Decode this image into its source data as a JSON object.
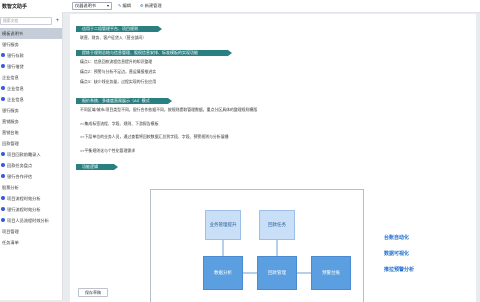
{
  "sidebar": {
    "title": "数智文助手",
    "search_placeholder": "搜索文档",
    "add_label": "+",
    "items": [
      {
        "label": "模板说明书",
        "level": 0,
        "active": true,
        "dot": ""
      },
      {
        "label": "银行服务",
        "level": 0,
        "active": false,
        "dot": ""
      },
      {
        "label": "银行存款",
        "level": 1,
        "active": false,
        "dot": "#3b5bdb"
      },
      {
        "label": "银行借贷",
        "level": 1,
        "active": false,
        "dot": "#3b5bdb"
      },
      {
        "label": "企业信息",
        "level": 0,
        "active": false,
        "dot": ""
      },
      {
        "label": "企业信息",
        "level": 1,
        "active": false,
        "dot": "#3b5bdb"
      },
      {
        "label": "企业信息",
        "level": 1,
        "active": false,
        "dot": "#3b5bdb"
      },
      {
        "label": "银行服务",
        "level": 0,
        "active": false,
        "dot": ""
      },
      {
        "label": "营销服务",
        "level": 0,
        "active": false,
        "dot": ""
      },
      {
        "label": "营销台账",
        "level": 0,
        "active": false,
        "dot": ""
      },
      {
        "label": "回款管理",
        "level": 0,
        "active": false,
        "dot": ""
      },
      {
        "label": "项目回款前瞻录入",
        "level": 1,
        "active": false,
        "dot": "#3b5bdb"
      },
      {
        "label": "回款任务盘点",
        "level": 1,
        "active": false,
        "dot": "#3b5bdb"
      },
      {
        "label": "银行合作评估",
        "level": 1,
        "active": false,
        "dot": "#3b5bdb"
      },
      {
        "label": "股票分析",
        "level": 0,
        "active": false,
        "dot": ""
      },
      {
        "label": "项目流程时效分析",
        "level": 1,
        "active": false,
        "dot": "#3b5bdb"
      },
      {
        "label": "银行流程时效分析",
        "level": 1,
        "active": false,
        "dot": "#3b5bdb"
      },
      {
        "label": "项目人员流程时效分析",
        "level": 1,
        "active": false,
        "dot": "#3b5bdb"
      },
      {
        "label": "项目管理",
        "level": 0,
        "active": false,
        "dot": ""
      },
      {
        "label": "任务清单",
        "level": 0,
        "active": false,
        "dot": ""
      }
    ]
  },
  "toolbar": {
    "doc_select": "仪器说明书",
    "edit_label": "编辑",
    "manage_label": "新建管理"
  },
  "doc": {
    "sections": [
      {
        "heading": "适用于二组管理平台、项目规则",
        "lines": [
          "联营、财务、客户征贷入（营业部间）"
        ]
      },
      {
        "heading": "提炼于规则总结与信息管理、股权信息安排、标准模板的实现功能",
        "lines": [
          "痛点1：信息回款流程信息提升的知识整理",
          "痛点2：预警与分析不足边，营运情报推进实",
          "痛点3：缺少线业务量，过程实现的行业应用"
        ]
      },
      {
        "heading": "报价系统、多维度直观展示（AI）模式",
        "lines": [
          "不同区域/城市/项目类型不同，银行合作依据不同，按规则提取管理数据，重点分区具体的整理规则模版",
          ">>集成标签流程、字段、规则、下游报告模板",
          ">>下层单位的业务人员，通过查看将回款数据汇总到字段、字段、预警规则与分析展播",
          ">>平衡规则化与个性化管理需求"
        ]
      },
      {
        "heading": "功能逻辑",
        "lines": []
      }
    ],
    "diagram": {
      "boxes": [
        {
          "label": "业务管理提升",
          "style": "light"
        },
        {
          "label": "回款任务",
          "style": "light"
        },
        {
          "label": "数据分析",
          "style": "dark"
        },
        {
          "label": "回款管理",
          "style": "dark"
        },
        {
          "label": "预警台账",
          "style": "dark"
        }
      ],
      "labels": [
        "台账自动化",
        "数据可视化",
        "推拉预警分析"
      ]
    },
    "save_label": "保存草稿"
  }
}
